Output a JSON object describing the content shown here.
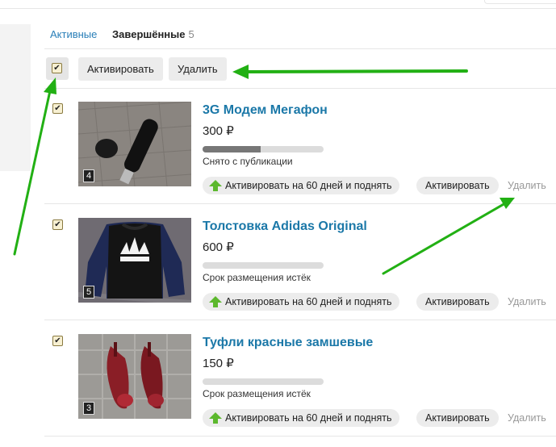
{
  "tabs": {
    "active_label": "Активные",
    "completed_label": "Завершённые",
    "completed_count": "5"
  },
  "toolbar": {
    "activate_label": "Активировать",
    "delete_label": "Удалить",
    "master_checkbox_glyph": "✔"
  },
  "items": [
    {
      "title": "3G Модем Мегафон",
      "price": "300 ₽",
      "photo_count": "4",
      "status": "Снято с публикации",
      "progress": 0.48,
      "boost_label": "Активировать на 60 дней и поднять",
      "activate_label": "Активировать",
      "delete_label": "Удалить",
      "checked_glyph": "✔"
    },
    {
      "title": "Толстовка Adidas Original",
      "price": "600 ₽",
      "photo_count": "5",
      "status": "Срок размещения истёк",
      "progress": 0,
      "boost_label": "Активировать на 60 дней и поднять",
      "activate_label": "Активировать",
      "delete_label": "Удалить",
      "checked_glyph": "✔"
    },
    {
      "title": "Туфли красные замшевые",
      "price": "150 ₽",
      "photo_count": "3",
      "status": "Срок размещения истёк",
      "progress": 0,
      "boost_label": "Активировать на 60 дней и поднять",
      "activate_label": "Активировать",
      "delete_label": "Удалить",
      "checked_glyph": "✔"
    }
  ],
  "colors": {
    "link": "#1b78a8",
    "annotation_arrow": "#22b014",
    "boost_icon": "#5cb82d"
  }
}
